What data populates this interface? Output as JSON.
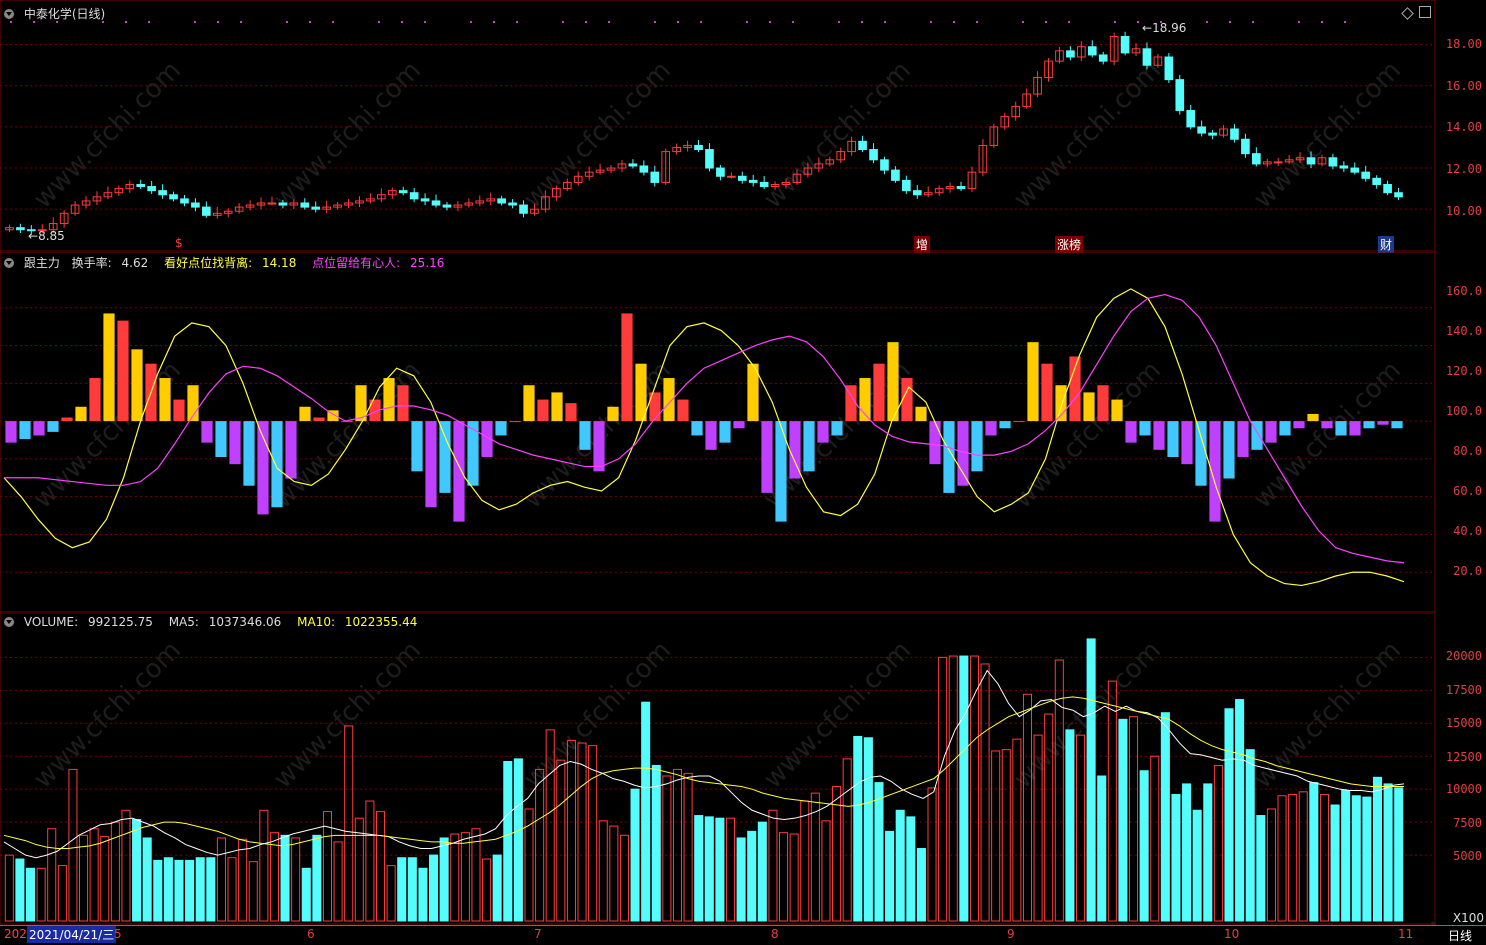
{
  "title": "中泰化学(日线)",
  "colors": {
    "up": "#ff3c3c",
    "down": "#54fcfc",
    "grid": "#7a0000",
    "axis": "#e04040",
    "yellow": "#ffff40",
    "magenta": "#ff40ff",
    "orange": "#ff8c00"
  },
  "price_panel": {
    "high_label": "18.96",
    "low_label": "8.85",
    "y_ticks": [
      "18.00",
      "16.00",
      "14.00",
      "12.00",
      "10.00"
    ],
    "markers": [
      {
        "text": "$",
        "color": "#ff3c3c"
      },
      {
        "text": "增",
        "color": "#ffffff"
      },
      {
        "text": "涨榜",
        "color": "#ffffff"
      },
      {
        "text": "财",
        "color": "#ffffff"
      }
    ],
    "closes": [
      9.1,
      9.0,
      8.95,
      9.0,
      9.3,
      9.8,
      10.2,
      10.4,
      10.6,
      10.8,
      11.0,
      11.2,
      11.1,
      10.9,
      10.7,
      10.5,
      10.3,
      10.1,
      9.7,
      9.8,
      9.9,
      10.1,
      10.2,
      10.3,
      10.3,
      10.2,
      10.3,
      10.1,
      10.0,
      10.1,
      10.2,
      10.3,
      10.4,
      10.5,
      10.7,
      10.9,
      10.8,
      10.5,
      10.4,
      10.2,
      10.1,
      10.2,
      10.3,
      10.4,
      10.5,
      10.3,
      10.2,
      9.8,
      10.0,
      10.6,
      11.0,
      11.3,
      11.6,
      11.8,
      11.9,
      12.0,
      12.2,
      12.1,
      11.8,
      11.3,
      12.8,
      13.0,
      13.1,
      12.9,
      12.0,
      11.6,
      11.6,
      11.4,
      11.3,
      11.1,
      11.2,
      11.3,
      11.7,
      12.0,
      12.2,
      12.4,
      12.8,
      13.3,
      12.9,
      12.4,
      11.9,
      11.4,
      10.9,
      10.7,
      10.8,
      11.0,
      11.1,
      11.0,
      11.8,
      13.1,
      14.0,
      14.5,
      15.0,
      15.6,
      16.4,
      17.2,
      17.7,
      17.4,
      17.9,
      17.5,
      17.2,
      18.4,
      17.6,
      17.8,
      17.0,
      17.4,
      16.3,
      14.8,
      14.0,
      13.7,
      13.6,
      13.9,
      13.4,
      12.7,
      12.2,
      12.3,
      12.3,
      12.4,
      12.5,
      12.2,
      12.5,
      12.1,
      12.0,
      11.8,
      11.5,
      11.2,
      10.8,
      10.6
    ],
    "opens": [
      9.0,
      9.1,
      9.0,
      8.95,
      9.0,
      9.3,
      9.8,
      10.2,
      10.4,
      10.6,
      10.8,
      11.0,
      11.2,
      11.1,
      10.9,
      10.7,
      10.5,
      10.3,
      10.1,
      9.7,
      9.8,
      9.9,
      10.1,
      10.2,
      10.3,
      10.3,
      10.2,
      10.3,
      10.1,
      10.0,
      10.1,
      10.2,
      10.3,
      10.4,
      10.5,
      10.7,
      10.9,
      10.8,
      10.5,
      10.4,
      10.2,
      10.1,
      10.2,
      10.3,
      10.4,
      10.5,
      10.3,
      10.2,
      9.8,
      10.0,
      10.6,
      11.0,
      11.3,
      11.6,
      11.8,
      11.9,
      12.0,
      12.2,
      12.1,
      11.8,
      11.3,
      12.8,
      13.0,
      13.1,
      12.9,
      12.0,
      11.6,
      11.6,
      11.4,
      11.3,
      11.1,
      11.2,
      11.3,
      11.7,
      12.0,
      12.2,
      12.4,
      12.8,
      13.3,
      12.9,
      12.4,
      11.9,
      11.4,
      10.9,
      10.7,
      10.8,
      11.0,
      11.1,
      11.0,
      11.8,
      13.1,
      14.0,
      14.5,
      15.0,
      15.6,
      16.4,
      17.2,
      17.7,
      17.4,
      17.9,
      17.5,
      17.2,
      18.4,
      17.6,
      17.8,
      17.0,
      17.4,
      16.3,
      14.8,
      14.0,
      13.7,
      13.6,
      13.9,
      13.4,
      12.7,
      12.2,
      12.3,
      12.3,
      12.4,
      12.5,
      12.2,
      12.5,
      12.1,
      12.0,
      11.8,
      11.5,
      11.2,
      10.8
    ]
  },
  "indicator_panel": {
    "name": "跟主力",
    "items": [
      {
        "label": "换手率:",
        "value": "4.62",
        "color": "#dddddd"
      },
      {
        "label": "看好点位找背离:",
        "value": "14.18",
        "color": "#ffff40"
      },
      {
        "label": "点位留给有心人:",
        "value": "25.16",
        "color": "#ff40ff"
      }
    ],
    "y_ticks": [
      "160.0",
      "140.0",
      "120.0",
      "100.0",
      "80.0",
      "60.0",
      "40.0",
      "20.0"
    ],
    "yellow_line": [
      70,
      60,
      48,
      38,
      33,
      36,
      48,
      70,
      100,
      125,
      145,
      152,
      150,
      140,
      120,
      95,
      75,
      68,
      66,
      72,
      85,
      100,
      118,
      128,
      124,
      110,
      88,
      70,
      58,
      53,
      56,
      62,
      66,
      68,
      65,
      63,
      70,
      90,
      115,
      140,
      150,
      152,
      148,
      140,
      128,
      110,
      85,
      65,
      52,
      50,
      56,
      72,
      100,
      118,
      110,
      90,
      75,
      60,
      52,
      56,
      62,
      80,
      110,
      135,
      155,
      165,
      170,
      165,
      150,
      125,
      95,
      65,
      40,
      25,
      18,
      14,
      13,
      15,
      18,
      20,
      20,
      18,
      15
    ],
    "magenta_line": [
      70,
      70,
      70,
      69,
      68,
      67,
      66,
      66,
      68,
      75,
      88,
      102,
      115,
      125,
      129,
      128,
      124,
      118,
      112,
      105,
      100,
      102,
      106,
      108,
      108,
      106,
      103,
      98,
      93,
      88,
      85,
      82,
      80,
      78,
      76,
      76,
      80,
      88,
      100,
      110,
      120,
      128,
      132,
      136,
      140,
      143,
      145,
      142,
      134,
      122,
      108,
      98,
      92,
      89,
      88,
      87,
      84,
      82,
      82,
      84,
      88,
      95,
      104,
      115,
      130,
      145,
      158,
      165,
      167,
      164,
      155,
      140,
      120,
      100,
      85,
      70,
      55,
      42,
      33,
      30,
      28,
      26,
      25
    ],
    "bars": [
      -6,
      -5,
      -4,
      -3,
      1,
      4,
      12,
      30,
      28,
      20,
      16,
      12,
      6,
      10,
      -6,
      -10,
      -12,
      -18,
      -26,
      -24,
      -16,
      4,
      1,
      3,
      0,
      10,
      6,
      12,
      10,
      -14,
      -24,
      -20,
      -28,
      -18,
      -10,
      -4,
      0,
      10,
      6,
      8,
      5,
      -8,
      -14,
      4,
      30,
      16,
      8,
      12,
      6,
      -4,
      -8,
      -6,
      -2,
      16,
      -20,
      -28,
      -16,
      -14,
      -6,
      -4,
      10,
      12,
      16,
      22,
      12,
      4,
      -12,
      -20,
      -18,
      -14,
      -4,
      -2,
      0,
      22,
      16,
      10,
      18,
      8,
      10,
      6,
      -6,
      -4,
      -8,
      -10,
      -12,
      -18,
      -28,
      -16,
      -10,
      -8,
      -6,
      -4,
      -2,
      2,
      -2,
      -4,
      -4,
      -2,
      -1,
      -2
    ],
    "bar_colors": "alternating"
  },
  "volume_panel": {
    "items": [
      {
        "label": "VOLUME:",
        "value": "992125.75",
        "color": "#dddddd"
      },
      {
        "label": "MA5:",
        "value": "1037346.06",
        "color": "#dddddd"
      },
      {
        "label": "MA10:",
        "value": "1022355.44",
        "color": "#ffff40"
      }
    ],
    "y_ticks": [
      "20000",
      "17500",
      "15000",
      "12500",
      "10000",
      "7500",
      "5000"
    ],
    "unit": "X100",
    "bars": [
      5000,
      4700,
      4000,
      4000,
      7000,
      4200,
      11500,
      6500,
      7000,
      6400,
      7500,
      8400,
      7700,
      6300,
      4600,
      4800,
      4600,
      4600,
      4800,
      4800,
      6300,
      4800,
      6200,
      4500,
      8400,
      6700,
      6500,
      6300,
      4000,
      6500,
      8300,
      6000,
      14800,
      7800,
      9100,
      8300,
      4200,
      4800,
      4800,
      4000,
      5000,
      6300,
      6600,
      6700,
      7000,
      4700,
      5000,
      12100,
      12300,
      8500,
      11500,
      14500,
      12200,
      13700,
      13500,
      13300,
      7600,
      7200,
      6500,
      10000,
      16600,
      11800,
      11000,
      11500,
      11200,
      8000,
      7900,
      7800,
      7800,
      6300,
      6800,
      7500,
      8400,
      6700,
      6600,
      9100,
      9700,
      7600,
      10200,
      12300,
      14000,
      13900,
      10500,
      6800,
      8400,
      7900,
      5500,
      10100,
      20000,
      20100,
      20100,
      20100,
      19500,
      12900,
      13000,
      13800,
      17200,
      14100,
      15700,
      19800,
      14500,
      14100,
      21400,
      11000,
      18200,
      15300,
      15500,
      11400,
      12500,
      15800,
      9600,
      10400,
      8400,
      10400,
      11800,
      16100,
      16800,
      13000,
      8000,
      8500,
      9500,
      9600,
      9800,
      10500,
      9600,
      8800,
      9900,
      9500,
      9400,
      10900,
      10400,
      10100
    ],
    "ma5": [
      6000,
      5500,
      5000,
      4800,
      5000,
      5300,
      5900,
      6500,
      6900,
      7300,
      7400,
      7700,
      7800,
      7500,
      7200,
      6700,
      6300,
      5800,
      5500,
      5200,
      5000,
      5200,
      5400,
      5500,
      5800,
      6000,
      6300,
      6600,
      6800,
      7000,
      7200,
      7000,
      6800,
      6700,
      6600,
      6500,
      6400,
      6000,
      5700,
      5500,
      5500,
      5700,
      5900,
      6200,
      6400,
      6600,
      7000,
      8000,
      8700,
      9300,
      10400,
      11100,
      11800,
      12100,
      11900,
      11500,
      11200,
      10800,
      10600,
      10300,
      10100,
      10200,
      10400,
      10700,
      10900,
      11000,
      11000,
      10600,
      9800,
      9000,
      8400,
      8100,
      7800,
      7700,
      7800,
      8000,
      8300,
      8700,
      9300,
      9900,
      10500,
      10900,
      11000,
      10600,
      10000,
      9600,
      9300,
      9800,
      12500,
      14500,
      15800,
      17500,
      19000,
      18000,
      16500,
      15500,
      16000,
      16700,
      16800,
      16200,
      16000,
      15500,
      15800,
      16300,
      15900,
      16300,
      15900,
      15800,
      15400,
      14500,
      13500,
      12700,
      12600,
      12400,
      12200,
      12300,
      12200,
      11800,
      11600,
      11400,
      11200,
      11000,
      10600,
      10400,
      10200,
      10000,
      9900,
      9900,
      9800,
      10000,
      10300,
      10400
    ],
    "ma10": [
      6500,
      6300,
      6100,
      5800,
      5600,
      5500,
      5500,
      5600,
      5700,
      5900,
      6200,
      6500,
      6800,
      7100,
      7300,
      7500,
      7500,
      7400,
      7200,
      7000,
      6800,
      6500,
      6200,
      6000,
      5900,
      5800,
      5700,
      5800,
      6000,
      6200,
      6400,
      6500,
      6500,
      6500,
      6500,
      6500,
      6400,
      6300,
      6200,
      6100,
      6000,
      6000,
      5900,
      5900,
      6000,
      6100,
      6200,
      6500,
      6800,
      7200,
      7700,
      8200,
      8800,
      9500,
      10200,
      10800,
      11200,
      11400,
      11500,
      11600,
      11600,
      11500,
      11300,
      11100,
      10800,
      10600,
      10500,
      10400,
      10300,
      10200,
      10000,
      9700,
      9500,
      9300,
      9200,
      9100,
      9000,
      8900,
      8800,
      8700,
      8800,
      9000,
      9300,
      9600,
      9900,
      10200,
      10500,
      10800,
      11500,
      12300,
      13100,
      13900,
      14500,
      15000,
      15500,
      15800,
      16100,
      16400,
      16700,
      16900,
      17000,
      16900,
      16700,
      16500,
      16300,
      16100,
      15900,
      15700,
      15500,
      15300,
      14800,
      14200,
      13700,
      13300,
      13000,
      12800,
      12600,
      12300,
      12100,
      11800,
      11600,
      11400,
      11200,
      11000,
      10800,
      10600,
      10400,
      10300,
      10200,
      10200,
      10200,
      10200
    ]
  },
  "x_axis": {
    "current_date": "2021/04/21/三",
    "year_prefix": "202",
    "months": [
      "5",
      "6",
      "7",
      "8",
      "9",
      "10",
      "11"
    ],
    "period_label": "日线"
  },
  "watermark": "www.cfchi.com",
  "icons": [
    "dropdown-icon",
    "diamond-icon",
    "window-icon"
  ]
}
